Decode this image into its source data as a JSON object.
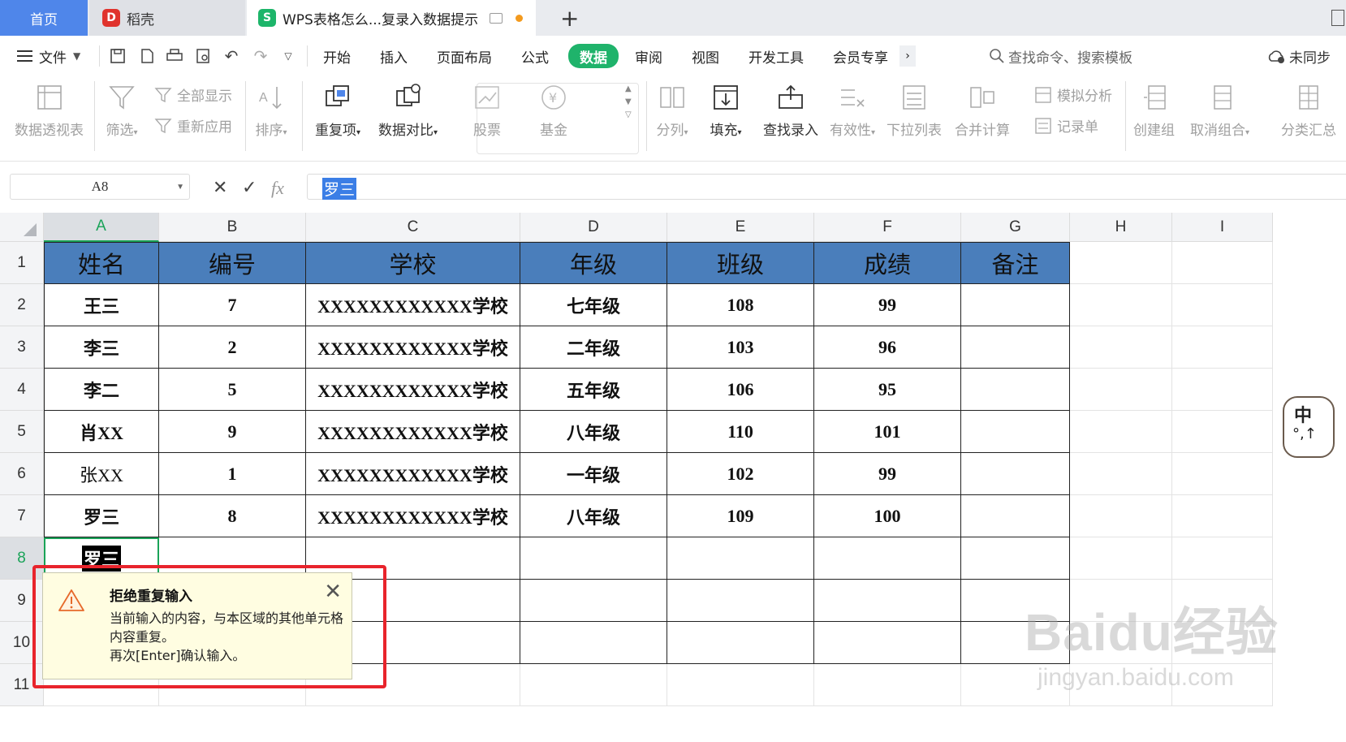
{
  "tabs": {
    "home": "首页",
    "daoke": "稻壳",
    "doc": "WPS表格怎么...复录入数据提示",
    "add": "+"
  },
  "menu": {
    "file": "文件",
    "items": [
      "开始",
      "插入",
      "页面布局",
      "公式",
      "数据",
      "审阅",
      "视图",
      "开发工具",
      "会员专享"
    ],
    "active": "数据",
    "search_placeholder": "查找命令、搜索模板",
    "sync": "未同步"
  },
  "ribbon": {
    "pivot": "数据透视表",
    "filter": "筛选",
    "show_all": "全部显示",
    "reapply": "重新应用",
    "sort": "排序",
    "duplicates": "重复项",
    "compare": "数据对比",
    "stock": "股票",
    "fund": "基金",
    "split": "分列",
    "fill": "填充",
    "lookup_entry": "查找录入",
    "validity": "有效性",
    "dropdown": "下拉列表",
    "consolidate": "合并计算",
    "simulate": "模拟分析",
    "record": "记录单",
    "create_group": "创建组",
    "ungroup": "取消组合",
    "subtotal": "分类汇总"
  },
  "formula_bar": {
    "name_box": "A8",
    "fx": "fx",
    "value": "罗三"
  },
  "sheet": {
    "columns": [
      "A",
      "B",
      "C",
      "D",
      "E",
      "F",
      "G",
      "H",
      "I"
    ],
    "rows": [
      "1",
      "2",
      "3",
      "4",
      "5",
      "6",
      "7",
      "8",
      "9",
      "10",
      "11"
    ],
    "headers": [
      "姓名",
      "编号",
      "学校",
      "年级",
      "班级",
      "成绩",
      "备注"
    ],
    "data": [
      [
        "王三",
        "7",
        "XXXXXXXXXXXX学校",
        "七年级",
        "108",
        "99",
        ""
      ],
      [
        "李三",
        "2",
        "XXXXXXXXXXXX学校",
        "二年级",
        "103",
        "96",
        ""
      ],
      [
        "李二",
        "5",
        "XXXXXXXXXXXX学校",
        "五年级",
        "106",
        "95",
        ""
      ],
      [
        "肖XX",
        "9",
        "XXXXXXXXXXXX学校",
        "八年级",
        "110",
        "101",
        ""
      ],
      [
        "张XX",
        "1",
        "XXXXXXXXXXXX学校",
        "一年级",
        "102",
        "99",
        ""
      ],
      [
        "罗三",
        "8",
        "XXXXXXXXXXXX学校",
        "八年级",
        "109",
        "100",
        ""
      ]
    ],
    "active_cell_value": "罗三"
  },
  "warning": {
    "title": "拒绝重复输入",
    "line1": "当前输入的内容，与本区域的其他单元格内容重复。",
    "line2": "再次[Enter]确认输入。"
  },
  "ime": {
    "label": "中",
    "sub": "°,↑"
  },
  "watermark": {
    "main": "Baidu经验",
    "sub": "jingyan.baidu.com"
  },
  "colors": {
    "header_fill": "#4a7ebb",
    "accent_green": "#1aa358",
    "active_tab": "#1fb36b",
    "highlight_box": "#e8242c"
  }
}
